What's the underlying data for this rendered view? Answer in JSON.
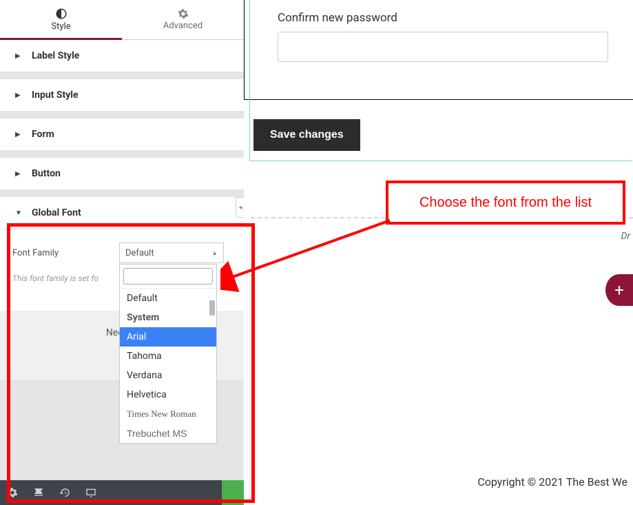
{
  "tabs": {
    "style": "Style",
    "advanced": "Advanced"
  },
  "panels": {
    "labelStyle": "Label Style",
    "inputStyle": "Input Style",
    "form": "Form",
    "button": "Button",
    "globalFont": "Global Font"
  },
  "globalFont": {
    "fieldLabel": "Font Family",
    "selected": "Default",
    "hint": "This font family is set fo",
    "options": {
      "default": "Default",
      "system": "System",
      "arial": "Arial",
      "tahoma": "Tahoma",
      "verdana": "Verdana",
      "helvetica": "Helvetica",
      "times": "Times New Roman",
      "trebuchet": "Trebuchet MS"
    }
  },
  "needHelp": "Need H",
  "main": {
    "confirmLabel": "Confirm new password",
    "saveButton": "Save changes",
    "dragHint": "Dr",
    "footer": "Copyright © 2021 The Best We"
  },
  "annotation": {
    "text": "Choose the font from the list"
  },
  "fab": "+"
}
